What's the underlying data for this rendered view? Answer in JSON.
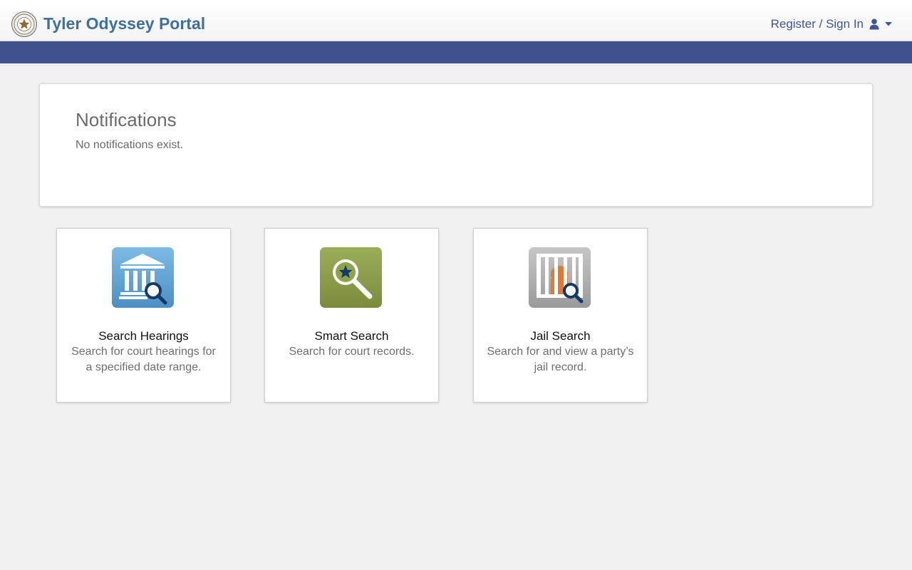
{
  "header": {
    "title": "Tyler Odyssey Portal",
    "signin_label": "Register / Sign In",
    "brand_color": "#3f6fa0",
    "nav_strip_color": "#40518e"
  },
  "notifications": {
    "title": "Notifications",
    "message": "No notifications exist."
  },
  "tiles": [
    {
      "title": "Search Hearings",
      "description": "Search for court hearings for a specified date range.",
      "icon": "courthouse-search-icon",
      "color": "#5aa1d6"
    },
    {
      "title": "Smart Search",
      "description": "Search for court records.",
      "icon": "magnifier-star-icon",
      "color": "#8a9c4a"
    },
    {
      "title": "Jail Search",
      "description": "Search for and view a party’s jail record.",
      "icon": "jail-search-icon",
      "color": "#a9a9a9"
    }
  ]
}
